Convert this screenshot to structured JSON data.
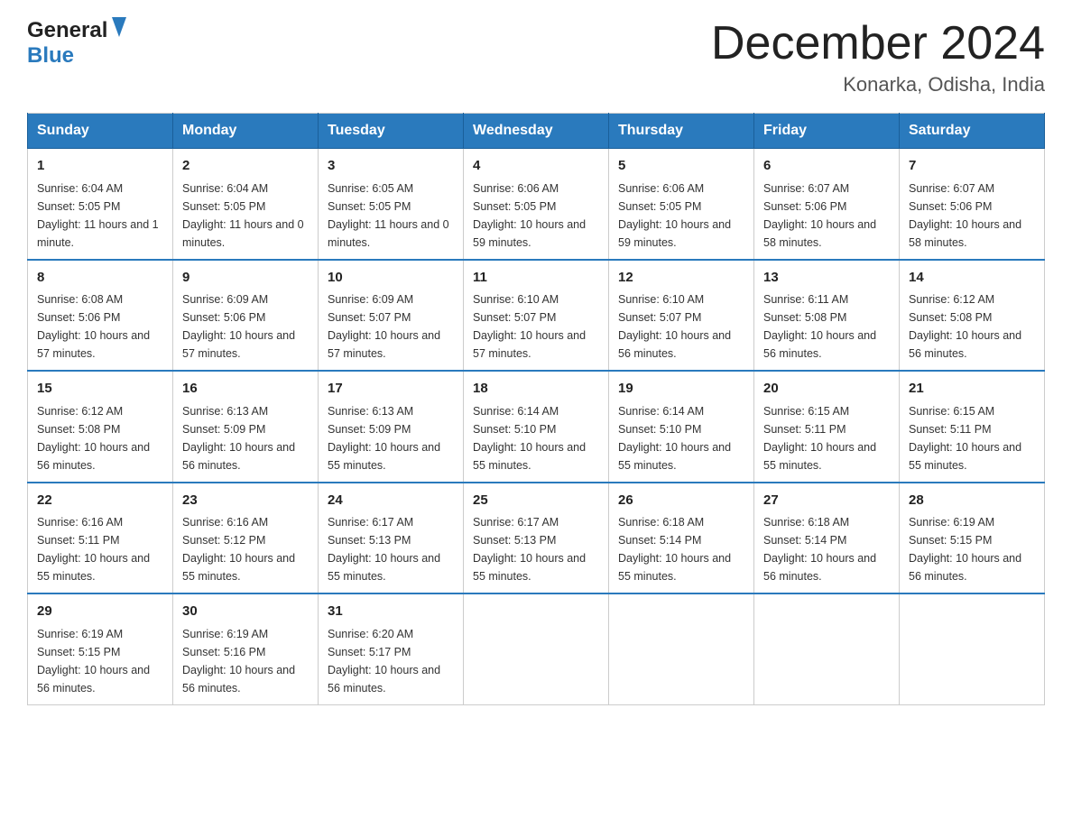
{
  "header": {
    "logo_general": "General",
    "logo_blue": "Blue",
    "month_title": "December 2024",
    "subtitle": "Konarka, Odisha, India"
  },
  "days_of_week": [
    "Sunday",
    "Monday",
    "Tuesday",
    "Wednesday",
    "Thursday",
    "Friday",
    "Saturday"
  ],
  "weeks": [
    [
      {
        "day": "1",
        "sunrise": "6:04 AM",
        "sunset": "5:05 PM",
        "daylight": "11 hours and 1 minute."
      },
      {
        "day": "2",
        "sunrise": "6:04 AM",
        "sunset": "5:05 PM",
        "daylight": "11 hours and 0 minutes."
      },
      {
        "day": "3",
        "sunrise": "6:05 AM",
        "sunset": "5:05 PM",
        "daylight": "11 hours and 0 minutes."
      },
      {
        "day": "4",
        "sunrise": "6:06 AM",
        "sunset": "5:05 PM",
        "daylight": "10 hours and 59 minutes."
      },
      {
        "day": "5",
        "sunrise": "6:06 AM",
        "sunset": "5:05 PM",
        "daylight": "10 hours and 59 minutes."
      },
      {
        "day": "6",
        "sunrise": "6:07 AM",
        "sunset": "5:06 PM",
        "daylight": "10 hours and 58 minutes."
      },
      {
        "day": "7",
        "sunrise": "6:07 AM",
        "sunset": "5:06 PM",
        "daylight": "10 hours and 58 minutes."
      }
    ],
    [
      {
        "day": "8",
        "sunrise": "6:08 AM",
        "sunset": "5:06 PM",
        "daylight": "10 hours and 57 minutes."
      },
      {
        "day": "9",
        "sunrise": "6:09 AM",
        "sunset": "5:06 PM",
        "daylight": "10 hours and 57 minutes."
      },
      {
        "day": "10",
        "sunrise": "6:09 AM",
        "sunset": "5:07 PM",
        "daylight": "10 hours and 57 minutes."
      },
      {
        "day": "11",
        "sunrise": "6:10 AM",
        "sunset": "5:07 PM",
        "daylight": "10 hours and 57 minutes."
      },
      {
        "day": "12",
        "sunrise": "6:10 AM",
        "sunset": "5:07 PM",
        "daylight": "10 hours and 56 minutes."
      },
      {
        "day": "13",
        "sunrise": "6:11 AM",
        "sunset": "5:08 PM",
        "daylight": "10 hours and 56 minutes."
      },
      {
        "day": "14",
        "sunrise": "6:12 AM",
        "sunset": "5:08 PM",
        "daylight": "10 hours and 56 minutes."
      }
    ],
    [
      {
        "day": "15",
        "sunrise": "6:12 AM",
        "sunset": "5:08 PM",
        "daylight": "10 hours and 56 minutes."
      },
      {
        "day": "16",
        "sunrise": "6:13 AM",
        "sunset": "5:09 PM",
        "daylight": "10 hours and 56 minutes."
      },
      {
        "day": "17",
        "sunrise": "6:13 AM",
        "sunset": "5:09 PM",
        "daylight": "10 hours and 55 minutes."
      },
      {
        "day": "18",
        "sunrise": "6:14 AM",
        "sunset": "5:10 PM",
        "daylight": "10 hours and 55 minutes."
      },
      {
        "day": "19",
        "sunrise": "6:14 AM",
        "sunset": "5:10 PM",
        "daylight": "10 hours and 55 minutes."
      },
      {
        "day": "20",
        "sunrise": "6:15 AM",
        "sunset": "5:11 PM",
        "daylight": "10 hours and 55 minutes."
      },
      {
        "day": "21",
        "sunrise": "6:15 AM",
        "sunset": "5:11 PM",
        "daylight": "10 hours and 55 minutes."
      }
    ],
    [
      {
        "day": "22",
        "sunrise": "6:16 AM",
        "sunset": "5:11 PM",
        "daylight": "10 hours and 55 minutes."
      },
      {
        "day": "23",
        "sunrise": "6:16 AM",
        "sunset": "5:12 PM",
        "daylight": "10 hours and 55 minutes."
      },
      {
        "day": "24",
        "sunrise": "6:17 AM",
        "sunset": "5:13 PM",
        "daylight": "10 hours and 55 minutes."
      },
      {
        "day": "25",
        "sunrise": "6:17 AM",
        "sunset": "5:13 PM",
        "daylight": "10 hours and 55 minutes."
      },
      {
        "day": "26",
        "sunrise": "6:18 AM",
        "sunset": "5:14 PM",
        "daylight": "10 hours and 55 minutes."
      },
      {
        "day": "27",
        "sunrise": "6:18 AM",
        "sunset": "5:14 PM",
        "daylight": "10 hours and 56 minutes."
      },
      {
        "day": "28",
        "sunrise": "6:19 AM",
        "sunset": "5:15 PM",
        "daylight": "10 hours and 56 minutes."
      }
    ],
    [
      {
        "day": "29",
        "sunrise": "6:19 AM",
        "sunset": "5:15 PM",
        "daylight": "10 hours and 56 minutes."
      },
      {
        "day": "30",
        "sunrise": "6:19 AM",
        "sunset": "5:16 PM",
        "daylight": "10 hours and 56 minutes."
      },
      {
        "day": "31",
        "sunrise": "6:20 AM",
        "sunset": "5:17 PM",
        "daylight": "10 hours and 56 minutes."
      },
      null,
      null,
      null,
      null
    ]
  ]
}
